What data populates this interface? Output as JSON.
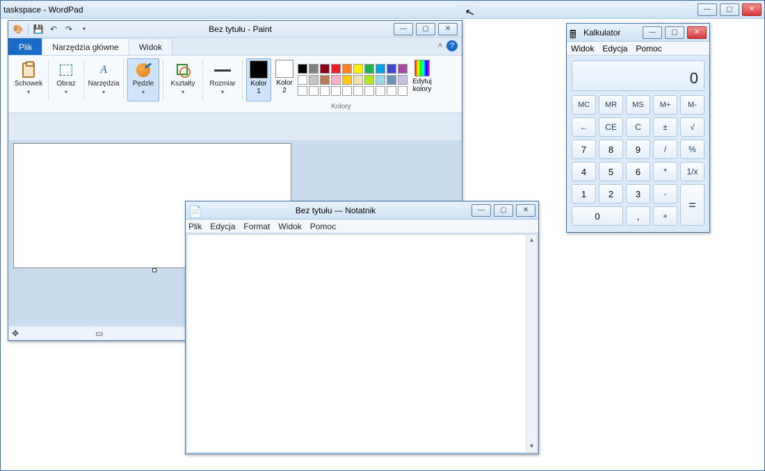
{
  "wordpad": {
    "title": "taskspace - WordPad"
  },
  "paint": {
    "title": "Bez tytułu - Paint",
    "tabs": {
      "file": "Plik",
      "home": "Narzędzia główne",
      "view": "Widok"
    },
    "groups": {
      "clipboard": "Schowek",
      "image": "Obraz",
      "tools": "Narzędzia",
      "brushes": "Pędzle",
      "shapes": "Kształty",
      "size": "Rozmiar",
      "color1": "Kolor\n1",
      "color2": "Kolor\n2",
      "edit_colors": "Edytuj\nkolory",
      "colors_label": "Kolory"
    }
  },
  "notepad": {
    "title": "Bez tytułu — Notatnik",
    "menu": {
      "file": "Plik",
      "edit": "Edycja",
      "format": "Format",
      "view": "Widok",
      "help": "Pomoc"
    }
  },
  "calculator": {
    "title": "Kalkulator",
    "menu": {
      "view": "Widok",
      "edit": "Edycja",
      "help": "Pomoc"
    },
    "display": "0",
    "keys": {
      "mc": "MC",
      "mr": "MR",
      "ms": "MS",
      "mplus": "M+",
      "mminus": "M-",
      "back": "←",
      "ce": "CE",
      "c": "C",
      "pm": "±",
      "sqrt": "√",
      "7": "7",
      "8": "8",
      "9": "9",
      "div": "/",
      "pct": "%",
      "4": "4",
      "5": "5",
      "6": "6",
      "mul": "*",
      "inv": "1/x",
      "1": "1",
      "2": "2",
      "3": "3",
      "sub": "-",
      "eq": "=",
      "0": "0",
      "dot": ",",
      "add": "+"
    }
  },
  "swatches": {
    "row1": [
      "#000000",
      "#7f7f7f",
      "#870014",
      "#ec1c24",
      "#ff7f27",
      "#fff200",
      "#22b14c",
      "#00a2e8",
      "#3f48cc",
      "#a349a4"
    ],
    "row2": [
      "#ffffff",
      "#c3c3c3",
      "#b97a57",
      "#ffaec9",
      "#ffc90e",
      "#efe4b0",
      "#b5e61d",
      "#99d9ea",
      "#7092be",
      "#c8bfe7"
    ],
    "row3": [
      "#ffffff",
      "#ffffff",
      "#ffffff",
      "#ffffff",
      "#ffffff",
      "#ffffff",
      "#ffffff",
      "#ffffff",
      "#ffffff",
      "#ffffff"
    ]
  }
}
